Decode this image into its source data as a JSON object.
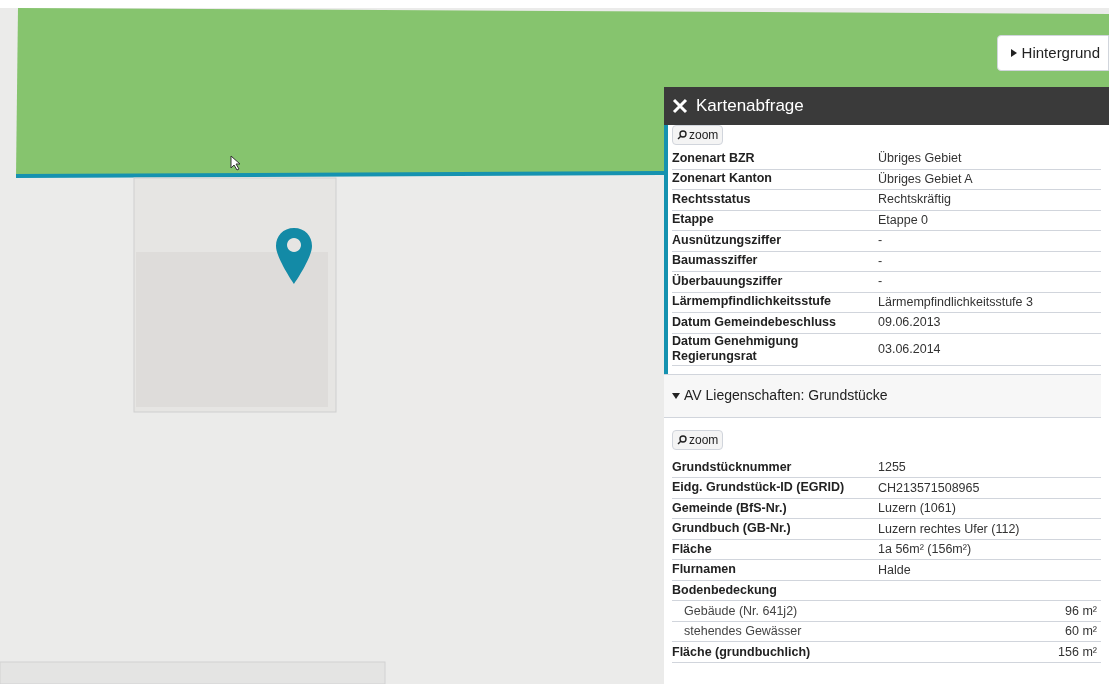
{
  "background_button": {
    "label": "Hintergrund",
    "expanded": false
  },
  "panel": {
    "title": "Kartenabfrage",
    "sections": [
      {
        "zoom_label": "zoom",
        "rows": [
          {
            "kind": "field",
            "label": "Zonenart BZR",
            "value": "Übriges Gebiet"
          },
          {
            "kind": "field",
            "label": "Zonenart Kanton",
            "value": "Übriges Gebiet A"
          },
          {
            "kind": "field",
            "label": "Rechtsstatus",
            "value": "Rechtskräftig"
          },
          {
            "kind": "field",
            "label": "Etappe",
            "value": "Etappe 0"
          },
          {
            "kind": "field",
            "label": "Ausnützungsziffer",
            "value": "-"
          },
          {
            "kind": "field",
            "label": "Baumassziffer",
            "value": "-"
          },
          {
            "kind": "field",
            "label": "Überbauungsziffer",
            "value": "-"
          },
          {
            "kind": "field",
            "label": "Lärmempfindlichkeitsstufe",
            "value": "Lärmempfindlichkeitsstufe 3"
          },
          {
            "kind": "field",
            "label": "Datum Gemeindebeschluss",
            "value": "09.06.2013"
          },
          {
            "kind": "field",
            "label": "Datum Genehmigung Regierungsrat",
            "value": "03.06.2014"
          }
        ]
      },
      {
        "title": "AV Liegenschaften: Grundstücke",
        "expanded": true,
        "zoom_label": "zoom",
        "rows": [
          {
            "kind": "field",
            "label": "Grundstücknummer",
            "value": "1255"
          },
          {
            "kind": "field",
            "label": "Eidg. Grundstück-ID (EGRID)",
            "value": "CH213571508965"
          },
          {
            "kind": "field",
            "label": "Gemeinde (BfS-Nr.)",
            "value": "Luzern (1061)"
          },
          {
            "kind": "field",
            "label": "Grundbuch (GB-Nr.)",
            "value": "Luzern rechtes Ufer (112)"
          },
          {
            "kind": "field",
            "label": "Fläche",
            "value": "1a 56m² (156m²)"
          },
          {
            "kind": "field",
            "label": "Flurnamen",
            "value": "Halde"
          },
          {
            "kind": "group",
            "label": "Bodenbedeckung"
          },
          {
            "kind": "sub",
            "label": "Gebäude (Nr. 641j2)",
            "value": "96 m²"
          },
          {
            "kind": "sub",
            "label": "stehendes Gewässer",
            "value": "60 m²"
          },
          {
            "kind": "total",
            "label": "Fläche (grundbuchlich)",
            "value": "156 m²"
          }
        ]
      }
    ]
  }
}
